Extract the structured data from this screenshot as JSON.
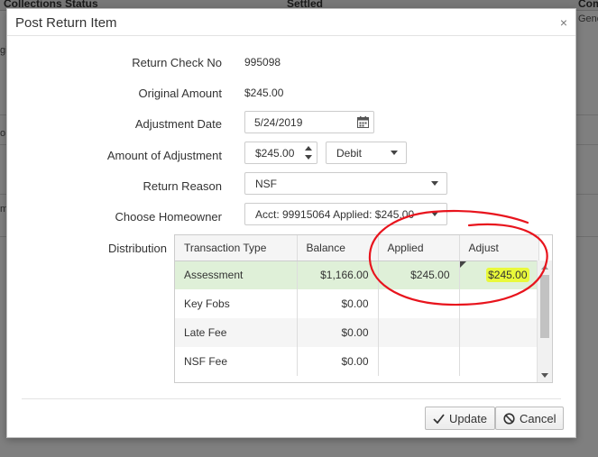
{
  "background": {
    "col_collections_status": "Collections Status",
    "col_settled": "Settled",
    "col_comm": "Comm",
    "frag_gene": "Gene",
    "frag_g": "gi",
    "frag_o": "o",
    "frag_me": "me"
  },
  "dialog": {
    "title": "Post Return Item",
    "close_label": "×",
    "fields": {
      "return_check_no": {
        "label": "Return Check No",
        "value": "995098"
      },
      "original_amount": {
        "label": "Original Amount",
        "value": "$245.00"
      },
      "adjustment_date": {
        "label": "Adjustment Date",
        "value": "5/24/2019"
      },
      "amount_of_adjustment": {
        "label": "Amount of Adjustment",
        "value": "$245.00",
        "type_value": "Debit"
      },
      "return_reason": {
        "label": "Return Reason",
        "value": "NSF"
      },
      "choose_homeowner": {
        "label": "Choose Homeowner",
        "value": "Acct: 99915064  Applied: $245.00"
      },
      "distribution": {
        "label": "Distribution"
      }
    },
    "grid": {
      "headers": [
        "Transaction Type",
        "Balance",
        "Applied",
        "Adjust"
      ],
      "rows": [
        {
          "type": "Assessment",
          "balance": "$1,166.00",
          "applied": "$245.00",
          "adjust": "$245.00"
        },
        {
          "type": "Key Fobs",
          "balance": "$0.00",
          "applied": "",
          "adjust": ""
        },
        {
          "type": "Late Fee",
          "balance": "$0.00",
          "applied": "",
          "adjust": ""
        },
        {
          "type": "NSF Fee",
          "balance": "$0.00",
          "applied": "",
          "adjust": ""
        }
      ]
    },
    "buttons": {
      "update": "Update",
      "cancel": "Cancel"
    }
  },
  "colors": {
    "selected_row": "#dff0d8",
    "highlight": "#e9f93a",
    "annotation": "#e8141d"
  }
}
